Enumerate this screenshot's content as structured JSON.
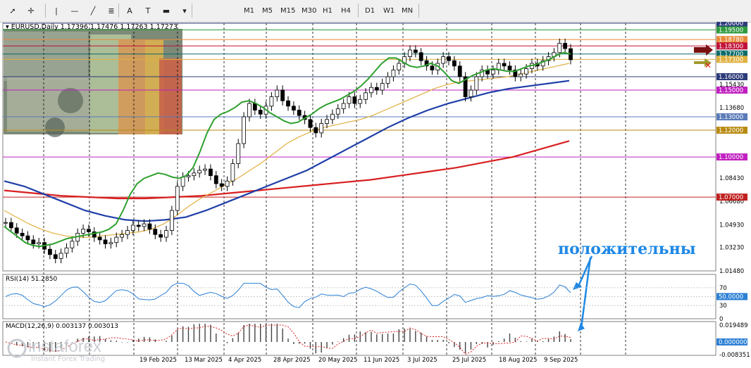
{
  "toolbar": {
    "tools": [
      {
        "name": "cursor-icon",
        "glyph": "➚"
      },
      {
        "name": "crosshair-icon",
        "glyph": "✛"
      },
      {
        "name": "vertical-line-icon",
        "glyph": "|"
      },
      {
        "name": "horizontal-line-icon",
        "glyph": "—"
      },
      {
        "name": "trendline-icon",
        "glyph": "╱"
      },
      {
        "name": "fibonacci-icon",
        "glyph": "≣"
      },
      {
        "name": "text-icon",
        "glyph": "A"
      },
      {
        "name": "label-icon",
        "glyph": "T"
      },
      {
        "name": "shapes-icon",
        "glyph": "▬"
      },
      {
        "name": "dropdown-icon",
        "glyph": "▾"
      }
    ],
    "timeframes": [
      "M1",
      "M5",
      "M15",
      "M30",
      "H1",
      "H4",
      "D1",
      "W1",
      "MN"
    ]
  },
  "chart": {
    "header": "▾ EURUSD,Daily  1.17396 1.17476 1.17263 1.17273",
    "annotation": "положительны",
    "watermark_brand": "instaforex",
    "watermark_tagline": "Instant Forex Trading",
    "rsi_label": "RSI(14) 51.2850",
    "macd_label": "MACD(12,26,9) 0.003137 0.003013"
  },
  "colors": {
    "up_candle": "#000000",
    "ema_fast": "#2ea02e",
    "ema_mid": "#e0b040",
    "ma_blue": "#1f3fa8",
    "ma_red": "#d81f1f",
    "indicator": "#2b7fd4",
    "annotation": "#1e88e5"
  },
  "chart_data": {
    "type": "line",
    "ylim": [
      1.0148,
      1.2
    ],
    "price_axis_labels": [
      "1.20000",
      "1.19500",
      "1.18780",
      "1.18300",
      "1.17700",
      "1.17300",
      "1.16000",
      "1.15430",
      "1.15000",
      "1.13680",
      "1.13000",
      "1.12000",
      "1.10000",
      "1.08430",
      "1.07000",
      "1.06680",
      "1.04930",
      "1.03230",
      "1.01480"
    ],
    "horizontal_levels": [
      {
        "value": 1.2,
        "label": "1.20000",
        "color": "#2d3b7a"
      },
      {
        "value": 1.195,
        "label": "1.19500",
        "color": "#2e9a3e"
      },
      {
        "value": 1.1878,
        "label": "1.18780",
        "color": "#e88a3a"
      },
      {
        "value": 1.183,
        "label": "1.18300",
        "color": "#c0123a"
      },
      {
        "value": 1.177,
        "label": "1.17700",
        "color": "#0b6b6b"
      },
      {
        "value": 1.173,
        "label": "1.17300",
        "color": "#e0b040"
      },
      {
        "value": 1.16,
        "label": "1.16000",
        "color": "#2d3b7a"
      },
      {
        "value": 1.15,
        "label": "1.15000",
        "color": "#c020c0"
      },
      {
        "value": 1.13,
        "label": "1.13000",
        "color": "#5a7ab8"
      },
      {
        "value": 1.12,
        "label": "1.12000",
        "color": "#b88a10"
      },
      {
        "value": 1.1,
        "label": "1.10000",
        "color": "#c020c0"
      },
      {
        "value": 1.07,
        "label": "1.07000",
        "color": "#c02020"
      }
    ],
    "x_labels": [
      "19 Feb 2025",
      "13 Mar 2025",
      "4 Apr 2025",
      "28 Apr 2025",
      "20 May 2025",
      "11 Jun 2025",
      "3 Jul 2025",
      "25 Jul 2025",
      "18 Aug 2025",
      "9 Sep 2025"
    ],
    "close_series": [
      1.051,
      1.047,
      1.043,
      1.041,
      1.038,
      1.035,
      1.036,
      1.031,
      1.027,
      1.024,
      1.028,
      1.032,
      1.037,
      1.043,
      1.046,
      1.044,
      1.04,
      1.038,
      1.035,
      1.036,
      1.04,
      1.042,
      1.045,
      1.049,
      1.048,
      1.05,
      1.046,
      1.042,
      1.04,
      1.045,
      1.06,
      1.078,
      1.085,
      1.086,
      1.088,
      1.09,
      1.091,
      1.086,
      1.08,
      1.078,
      1.082,
      1.095,
      1.11,
      1.13,
      1.14,
      1.135,
      1.132,
      1.138,
      1.145,
      1.15,
      1.142,
      1.138,
      1.135,
      1.131,
      1.128,
      1.122,
      1.118,
      1.125,
      1.128,
      1.132,
      1.136,
      1.14,
      1.145,
      1.14,
      1.143,
      1.148,
      1.152,
      1.15,
      1.155,
      1.16,
      1.165,
      1.17,
      1.175,
      1.18,
      1.178,
      1.172,
      1.168,
      1.165,
      1.17,
      1.175,
      1.172,
      1.168,
      1.16,
      1.145,
      1.15,
      1.16,
      1.165,
      1.162,
      1.165,
      1.17,
      1.168,
      1.165,
      1.16,
      1.162,
      1.166,
      1.17,
      1.168,
      1.172,
      1.175,
      1.178,
      1.185,
      1.181,
      1.1727
    ],
    "ema_fast_series": [
      1.048,
      1.044,
      1.04,
      1.036,
      1.034,
      1.033,
      1.034,
      1.035,
      1.037,
      1.039,
      1.04,
      1.041,
      1.042,
      1.043,
      1.044,
      1.046,
      1.05,
      1.06,
      1.072,
      1.08,
      1.084,
      1.086,
      1.088,
      1.087,
      1.085,
      1.084,
      1.086,
      1.092,
      1.104,
      1.118,
      1.128,
      1.132,
      1.134,
      1.137,
      1.141,
      1.142,
      1.14,
      1.137,
      1.133,
      1.13,
      1.127,
      1.125,
      1.126,
      1.129,
      1.132,
      1.136,
      1.139,
      1.141,
      1.143,
      1.146,
      1.149,
      1.153,
      1.158,
      1.164,
      1.17,
      1.174,
      1.174,
      1.171,
      1.168,
      1.167,
      1.168,
      1.17,
      1.168,
      1.163,
      1.157,
      1.155,
      1.158,
      1.161,
      1.163,
      1.165,
      1.166,
      1.165,
      1.164,
      1.164,
      1.166,
      1.168,
      1.169,
      1.171,
      1.173,
      1.176,
      1.178,
      1.177
    ],
    "ema_mid_series": [
      1.06,
      1.055,
      1.05,
      1.046,
      1.043,
      1.041,
      1.04,
      1.04,
      1.041,
      1.042,
      1.043,
      1.044,
      1.046,
      1.05,
      1.056,
      1.063,
      1.069,
      1.074,
      1.079,
      1.084,
      1.09,
      1.096,
      1.103,
      1.11,
      1.115,
      1.119,
      1.122,
      1.124,
      1.126,
      1.128,
      1.131,
      1.135,
      1.139,
      1.143,
      1.147,
      1.151,
      1.154,
      1.156,
      1.157,
      1.158,
      1.159,
      1.16,
      1.162,
      1.164,
      1.166,
      1.168,
      1.17
    ],
    "ma_blue_series": [
      1.082,
      1.078,
      1.072,
      1.066,
      1.06,
      1.056,
      1.053,
      1.052,
      1.053,
      1.055,
      1.06,
      1.066,
      1.072,
      1.078,
      1.084,
      1.09,
      1.098,
      1.106,
      1.114,
      1.122,
      1.129,
      1.135,
      1.14,
      1.144,
      1.148,
      1.151,
      1.153,
      1.155,
      1.157
    ],
    "ma_red_series": [
      1.075,
      1.073,
      1.071,
      1.07,
      1.069,
      1.069,
      1.07,
      1.071,
      1.073,
      1.075,
      1.077,
      1.079,
      1.081,
      1.083,
      1.086,
      1.089,
      1.092,
      1.096,
      1.1,
      1.106,
      1.112
    ]
  },
  "rsi": {
    "axis_labels": [
      "70",
      "50.0000",
      "30",
      "0"
    ]
  },
  "macd": {
    "axis_labels": [
      "0.019489",
      "0.000000",
      "-0.008351"
    ]
  }
}
